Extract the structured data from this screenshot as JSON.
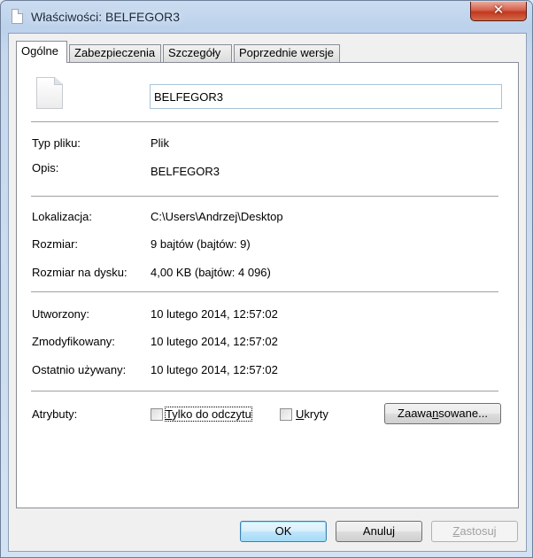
{
  "window": {
    "title": "Właściwości: BELFEGOR3",
    "close_glyph": "✕"
  },
  "tabs": [
    {
      "label": "Ogólne"
    },
    {
      "label": "Zabezpieczenia"
    },
    {
      "label": "Szczegóły"
    },
    {
      "label": "Poprzednie wersje"
    }
  ],
  "general": {
    "file_name": "BELFEGOR3",
    "fields": {
      "type_label": "Typ pliku:",
      "type_value": "Plik",
      "desc_label": "Opis:",
      "desc_value": "BELFEGOR3",
      "location_label": "Lokalizacja:",
      "location_value": "C:\\Users\\Andrzej\\Desktop",
      "size_label": "Rozmiar:",
      "size_value": "9 bajtów (bajtów: 9)",
      "disk_size_label": "Rozmiar na dysku:",
      "disk_size_value": "4,00 KB (bajtów: 4 096)",
      "created_label": "Utworzony:",
      "created_value": "10 lutego 2014, 12:57:02",
      "modified_label": "Zmodyfikowany:",
      "modified_value": "10 lutego 2014, 12:57:02",
      "accessed_label": "Ostatnio używany:",
      "accessed_value": "10 lutego 2014, 12:57:02"
    },
    "attributes": {
      "label": "Atrybuty:",
      "readonly_label_mnemonic": "T",
      "readonly_label_rest": "ylko do odczytu",
      "readonly_checked": false,
      "hidden_label_mnemonic": "U",
      "hidden_label_rest": "kryty",
      "hidden_checked": false,
      "advanced_pre": "Zaawa",
      "advanced_mnemonic": "n",
      "advanced_post": "sowane..."
    }
  },
  "footer": {
    "ok_label": "OK",
    "cancel_label": "Anuluj",
    "apply_mnemonic": "Z",
    "apply_rest": "astosuj"
  },
  "icons": {
    "title_icon": "file-icon",
    "file_icon": "file-icon"
  }
}
